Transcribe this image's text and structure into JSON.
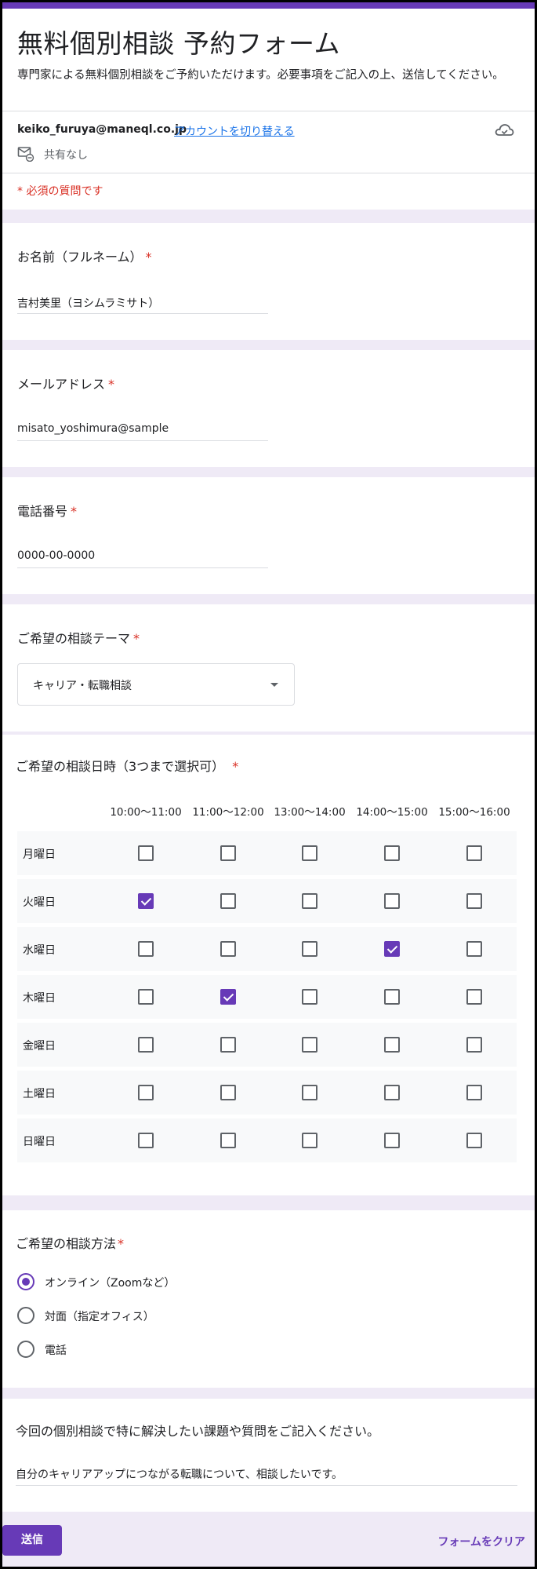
{
  "form": {
    "title": "無料個別相談 予約フォーム",
    "description": "専門家による無料個別相談をご予約いただけます。必要事項をご記入の上、送信してください。",
    "account_email": "keiko_furuya@maneql.co.jp",
    "switch_account_label": "アカウントを切り替える",
    "share_status": "共有なし",
    "required_note": "* 必須の質問です",
    "accent_color": "#673ab7"
  },
  "questions": {
    "name": {
      "title": "お名前（フルネーム）",
      "required_mark": "*",
      "value": "吉村美里（ヨシムラミサト）"
    },
    "email": {
      "title": "メールアドレス",
      "required_mark": "*",
      "value": "misato_yoshimura@sample"
    },
    "phone": {
      "title": "電話番号",
      "required_mark": "*",
      "value": "0000-00-0000"
    },
    "theme": {
      "title": "ご希望の相談テーマ",
      "required_mark": "*",
      "selected": "キャリア・転職相談"
    },
    "datetime": {
      "title": "ご希望の相談日時（3つまで選択可）",
      "required_mark": "*",
      "columns": [
        "10:00〜11:00",
        "11:00〜12:00",
        "13:00〜14:00",
        "14:00〜15:00",
        "15:00〜16:00"
      ],
      "rows": [
        {
          "label": "月曜日",
          "checked": [
            false,
            false,
            false,
            false,
            false
          ]
        },
        {
          "label": "火曜日",
          "checked": [
            true,
            false,
            false,
            false,
            false
          ]
        },
        {
          "label": "水曜日",
          "checked": [
            false,
            false,
            false,
            true,
            false
          ]
        },
        {
          "label": "木曜日",
          "checked": [
            false,
            true,
            false,
            false,
            false
          ]
        },
        {
          "label": "金曜日",
          "checked": [
            false,
            false,
            false,
            false,
            false
          ]
        },
        {
          "label": "土曜日",
          "checked": [
            false,
            false,
            false,
            false,
            false
          ]
        },
        {
          "label": "日曜日",
          "checked": [
            false,
            false,
            false,
            false,
            false
          ]
        }
      ]
    },
    "method": {
      "title": "ご希望の相談方法",
      "required_mark": "*",
      "options": [
        {
          "label": "オンライン（Zoomなど）",
          "selected": true
        },
        {
          "label": "対面（指定オフィス）",
          "selected": false
        },
        {
          "label": "電話",
          "selected": false
        }
      ]
    },
    "comment": {
      "title": "今回の個別相談で特に解決したい課題や質問をご記入ください。",
      "value": "自分のキャリアアップにつながる転職について、相談したいです。"
    }
  },
  "footer": {
    "submit_label": "送信",
    "clear_label": "フォームをクリア"
  },
  "icons": {
    "cloud": "cloud-icon",
    "mail": "mail-share-icon",
    "dropdown": "dropdown-arrow-icon"
  }
}
